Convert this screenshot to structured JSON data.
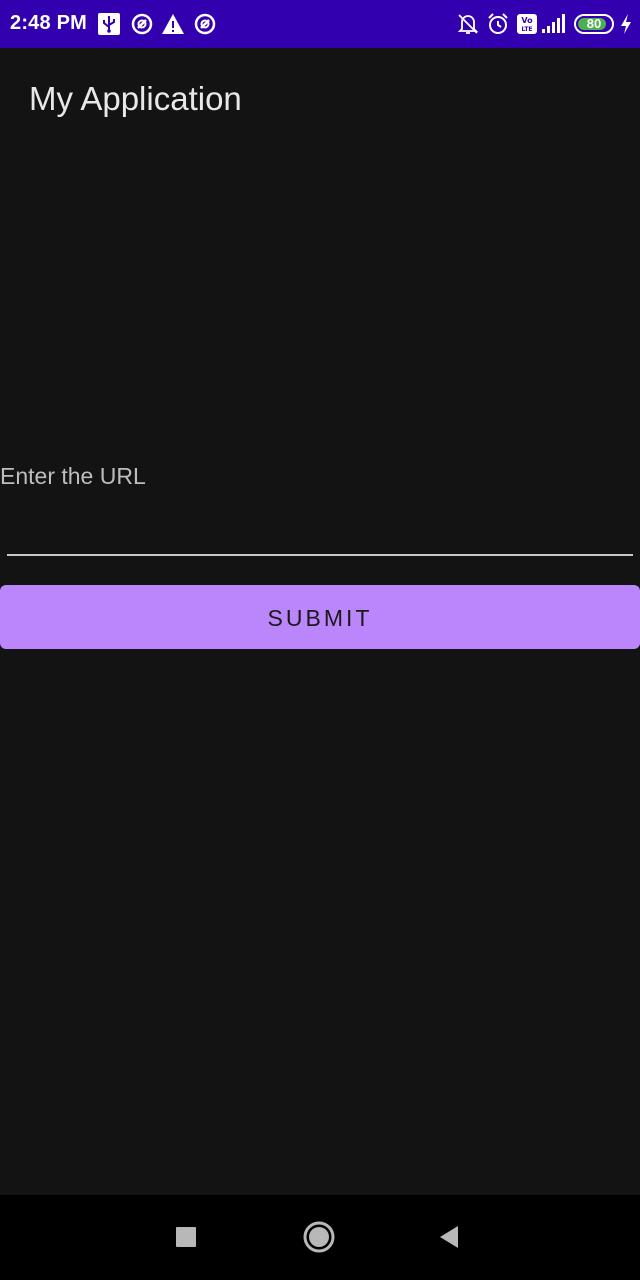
{
  "status_bar": {
    "time": "2:48 PM",
    "battery_level": "80",
    "icons": [
      "usb-icon",
      "data-saver-icon",
      "warning-icon",
      "data-saver-icon",
      "mute-icon",
      "alarm-icon",
      "volte-icon",
      "signal-icon",
      "battery-icon",
      "charging-icon"
    ]
  },
  "app_bar": {
    "title": "My Application"
  },
  "form": {
    "url_label": "Enter the URL",
    "url_value": "",
    "submit_label": "SUBMIT"
  },
  "nav_bar": {
    "buttons": [
      "recents-button",
      "home-button",
      "back-button"
    ]
  },
  "colors": {
    "status_bar": "#3300b0",
    "background": "#131313",
    "accent": "#bb86fc",
    "battery_fill": "#4caf50"
  }
}
